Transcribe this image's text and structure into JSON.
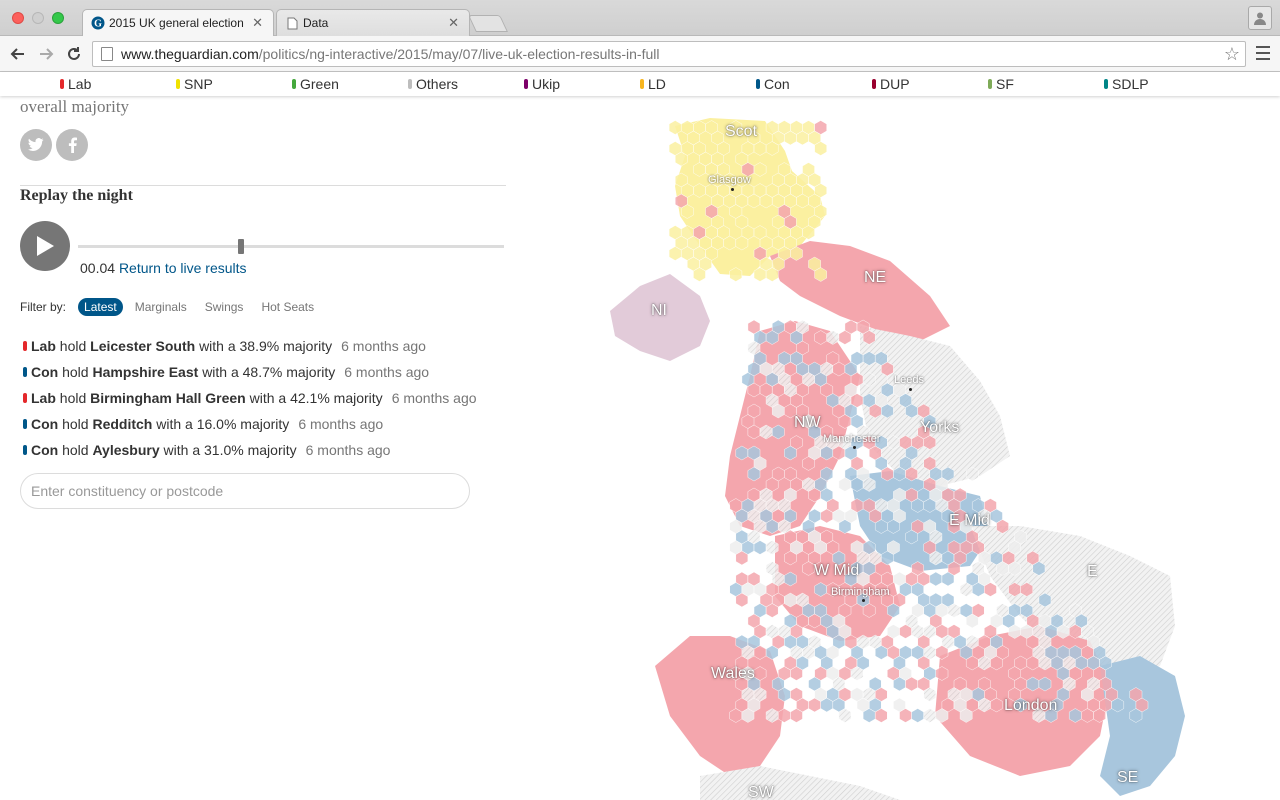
{
  "browser": {
    "tabs": [
      {
        "title": "2015 UK general election",
        "active": true
      },
      {
        "title": "Data",
        "active": false
      }
    ],
    "url_domain": "www.theguardian.com",
    "url_path": "/politics/ng-interactive/2015/may/07/live-uk-election-results-in-full"
  },
  "legend": [
    {
      "label": "Lab",
      "color": "#e4282b"
    },
    {
      "label": "SNP",
      "color": "#f0e200"
    },
    {
      "label": "Green",
      "color": "#44a83c"
    },
    {
      "label": "Others",
      "color": "#bdbdbd"
    },
    {
      "label": "Ukip",
      "color": "#7d0069"
    },
    {
      "label": "LD",
      "color": "#f7b51e"
    },
    {
      "label": "Con",
      "color": "#005789"
    },
    {
      "label": "DUP",
      "color": "#99002e"
    },
    {
      "label": "SF",
      "color": "#7eaa58"
    },
    {
      "label": "SDLP",
      "color": "#008587"
    }
  ],
  "sidebar": {
    "majority_text": "overall majority",
    "replay_title": "Replay the night",
    "time": "00.04",
    "return_link": "Return to live results",
    "filter_label": "Filter by:",
    "filters": [
      "Latest",
      "Marginals",
      "Swings",
      "Hot Seats"
    ],
    "results": [
      {
        "party": "Lab",
        "color": "#e4282b",
        "verb": "hold",
        "seat": "Leicester South",
        "text": "with a 38.9% majority",
        "ago": "6 months ago"
      },
      {
        "party": "Con",
        "color": "#005789",
        "verb": "hold",
        "seat": "Hampshire East",
        "text": "with a 48.7% majority",
        "ago": "6 months ago"
      },
      {
        "party": "Lab",
        "color": "#e4282b",
        "verb": "hold",
        "seat": "Birmingham Hall Green",
        "text": "with a 42.1% majority",
        "ago": "6 months ago"
      },
      {
        "party": "Con",
        "color": "#005789",
        "verb": "hold",
        "seat": "Redditch",
        "text": "with a 16.0% majority",
        "ago": "6 months ago"
      },
      {
        "party": "Con",
        "color": "#005789",
        "verb": "hold",
        "seat": "Aylesbury",
        "text": "with a 31.0% majority",
        "ago": "6 months ago"
      }
    ],
    "search_placeholder": "Enter constituency or postcode"
  },
  "map": {
    "regions": [
      "Scot",
      "NI",
      "NE",
      "NW",
      "Yorks",
      "E Mid",
      "W Mid",
      "E",
      "Wales",
      "London",
      "SE",
      "SW"
    ],
    "cities": [
      "Glasgow",
      "Leeds",
      "Manchester",
      "Birmingham"
    ],
    "colors": {
      "lab": "#f4a6ad",
      "con": "#a8c6dd",
      "snp": "#fbf0a0",
      "ld": "#fde29a",
      "ukip": "#d2a6cb",
      "uncounted": "#eeeeee"
    }
  }
}
